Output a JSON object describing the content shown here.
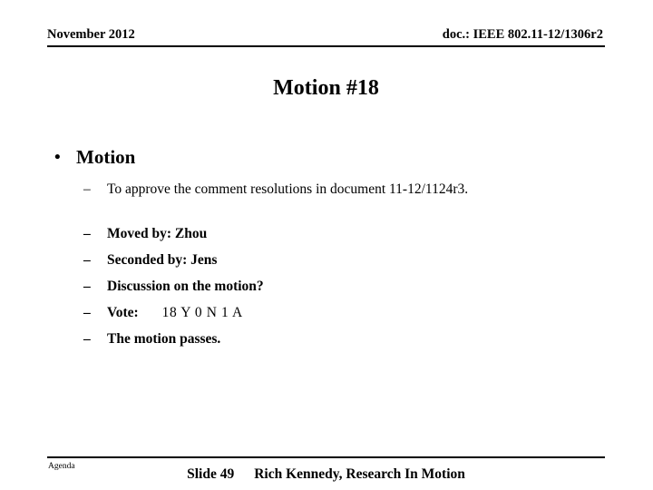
{
  "header": {
    "date": "November 2012",
    "doc_reference": "doc.: IEEE 802.11-12/1306r2"
  },
  "title": "Motion #18",
  "body": {
    "bullet_marker": "•",
    "dash_marker": "–",
    "level1": "Motion",
    "items": [
      "To approve the comment resolutions in document 11-12/1124r3.",
      "Moved by: Zhou",
      "Seconded by: Jens",
      "Discussion on the motion?",
      "The motion passes."
    ],
    "vote": {
      "label": "Vote:",
      "tally": "18 Y   0 N  1 A"
    }
  },
  "footer": {
    "agenda": "Agenda",
    "slide_number": "Slide 49",
    "author": "Rich Kennedy, Research In Motion"
  }
}
